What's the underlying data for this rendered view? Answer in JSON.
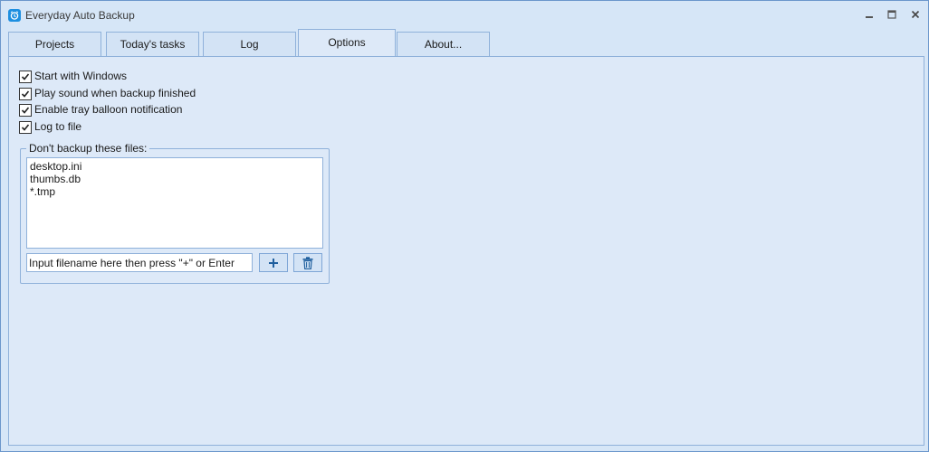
{
  "window": {
    "title": "Everyday Auto Backup",
    "controls": [
      "minimize",
      "maximize",
      "close"
    ]
  },
  "tabs": [
    {
      "label": "Projects",
      "active": false
    },
    {
      "label": "Today's tasks",
      "active": false
    },
    {
      "label": "Log",
      "active": false
    },
    {
      "label": "Options",
      "active": true
    },
    {
      "label": "About...",
      "active": false
    }
  ],
  "options": {
    "checkboxes": [
      {
        "label": "Start with Windows",
        "checked": true
      },
      {
        "label": "Play sound when backup finished",
        "checked": true
      },
      {
        "label": "Enable tray balloon notification",
        "checked": true
      },
      {
        "label": "Log to file",
        "checked": true
      }
    ],
    "exclude_group": {
      "title": "Don't backup these files:",
      "items": [
        "desktop.ini",
        "thumbs.db",
        "*.tmp"
      ],
      "input_value": "Input filename here then press \"+\" or Enter",
      "add_icon": "plus-icon",
      "delete_icon": "trash-icon"
    }
  },
  "colors": {
    "background": "#d6e6f7",
    "panel": "#dde9f8",
    "border": "#8fb1da",
    "accent": "#1d8fe0"
  }
}
